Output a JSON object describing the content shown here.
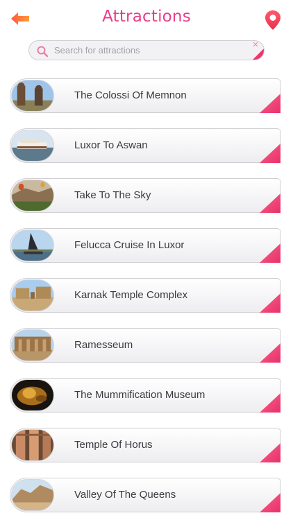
{
  "header": {
    "title": "Attractions",
    "back_icon": "arrow-left-icon",
    "location_icon": "map-pin-icon"
  },
  "search": {
    "placeholder": "Search for attractions",
    "value": ""
  },
  "colors": {
    "accent": "#e93d8a",
    "corner_gradient_start": "#f0477a",
    "corner_gradient_end": "#ff7a3c",
    "back_arrow": "#ff6a3d"
  },
  "attractions": [
    {
      "label": "The Colossi Of Memnon"
    },
    {
      "label": "Luxor To Aswan"
    },
    {
      "label": "Take To The Sky"
    },
    {
      "label": "Felucca Cruise In Luxor"
    },
    {
      "label": "Karnak Temple Complex"
    },
    {
      "label": "Ramesseum"
    },
    {
      "label": "The Mummification Museum"
    },
    {
      "label": "Temple Of Horus"
    },
    {
      "label": "Valley Of The Queens"
    }
  ]
}
